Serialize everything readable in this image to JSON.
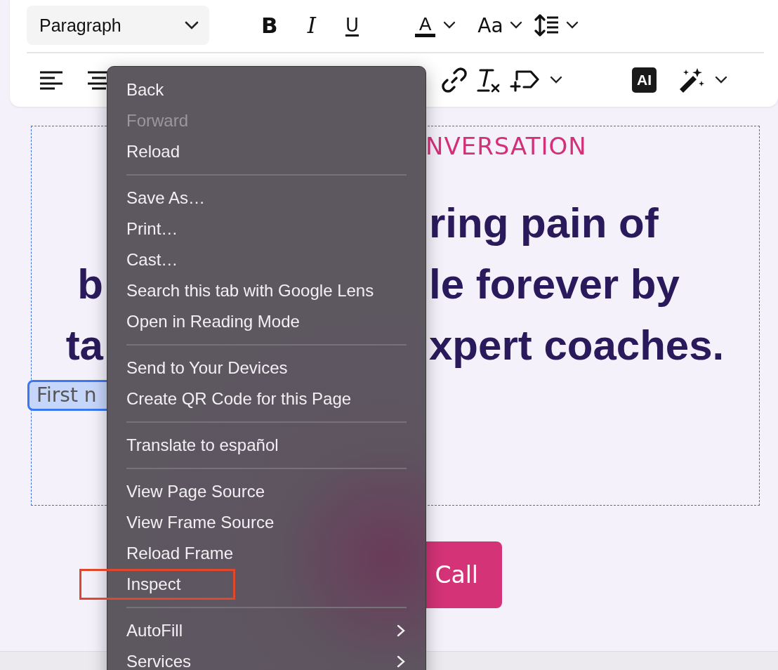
{
  "toolbar": {
    "block_style": "Paragraph",
    "format_buttons": [
      {
        "kind": "bold",
        "glyph": "B"
      },
      {
        "kind": "italic",
        "glyph": "I"
      },
      {
        "kind": "underline",
        "glyph": "U"
      }
    ],
    "text_color_glyph": "A",
    "font_size_glyph": "Aa",
    "ai_label": "AI"
  },
  "editor": {
    "eyebrow": "NVERSATION",
    "headline_lines": [
      {
        "right": "ring pain of"
      },
      {
        "left": "b",
        "right": "le forever by"
      },
      {
        "left": "ta",
        "right": "xpert coaches."
      }
    ],
    "name_field": {
      "value": "First n"
    },
    "cta_button": "Call"
  },
  "context_menu": {
    "groups": [
      [
        {
          "label": "Back",
          "disabled": false
        },
        {
          "label": "Forward",
          "disabled": true
        },
        {
          "label": "Reload",
          "disabled": false
        }
      ],
      [
        {
          "label": "Save As…",
          "disabled": false
        },
        {
          "label": "Print…",
          "disabled": false
        },
        {
          "label": "Cast…",
          "disabled": false
        },
        {
          "label": "Search this tab with Google Lens",
          "disabled": false
        },
        {
          "label": "Open in Reading Mode",
          "disabled": false
        }
      ],
      [
        {
          "label": "Send to Your Devices",
          "disabled": false
        },
        {
          "label": "Create QR Code for this Page",
          "disabled": false
        }
      ],
      [
        {
          "label": "Translate to español",
          "disabled": false
        }
      ],
      [
        {
          "label": "View Page Source",
          "disabled": false
        },
        {
          "label": "View Frame Source",
          "disabled": false
        },
        {
          "label": "Reload Frame",
          "disabled": false
        },
        {
          "label": "Inspect",
          "disabled": false,
          "outlined": true
        }
      ],
      [
        {
          "label": "AutoFill",
          "disabled": false,
          "submenu": true
        },
        {
          "label": "Services",
          "disabled": false,
          "submenu": true
        }
      ]
    ]
  }
}
